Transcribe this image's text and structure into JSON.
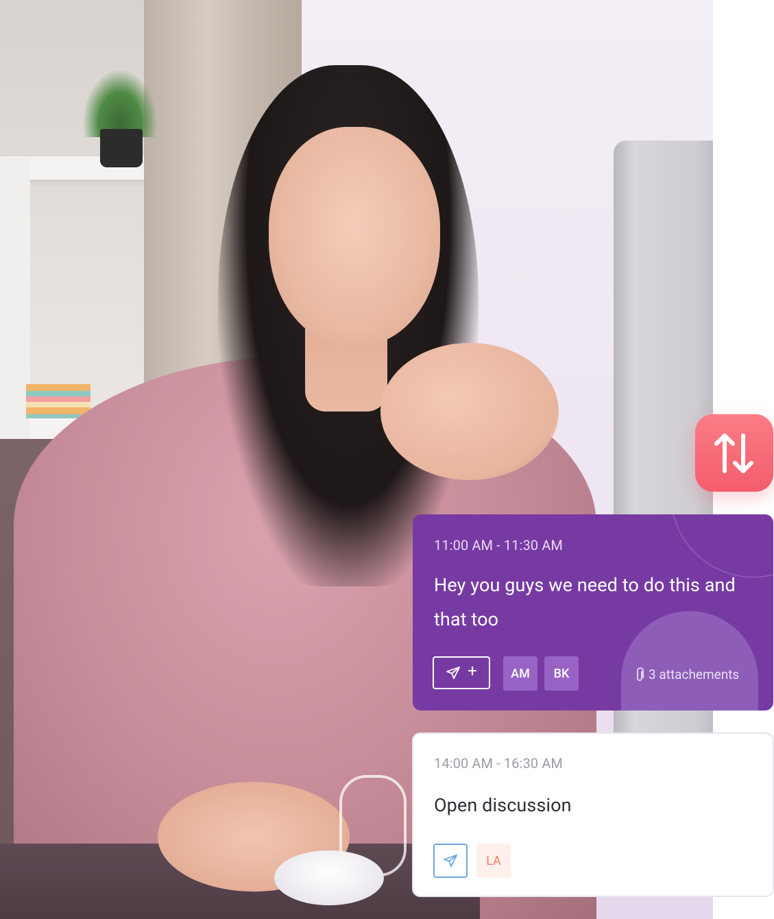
{
  "sync_button": {
    "icon": "arrows-up-down-icon",
    "color": "#f45d6d"
  },
  "events": [
    {
      "time": "11:00 AM - 11:30 AM",
      "title": "Hey you guys we need to do this and that too",
      "send_icon": "paper-plane-icon",
      "add_label": "+",
      "participants": [
        "AM",
        "BK"
      ],
      "attachments_label": "3 attachements",
      "attachments_icon": "paperclip-icon",
      "background_color": "#773aa3"
    },
    {
      "time": "14:00 AM - 16:30 AM",
      "title": "Open discussion",
      "send_icon": "paper-plane-icon",
      "participants": [
        "LA"
      ],
      "background_color": "#ffffff"
    }
  ]
}
